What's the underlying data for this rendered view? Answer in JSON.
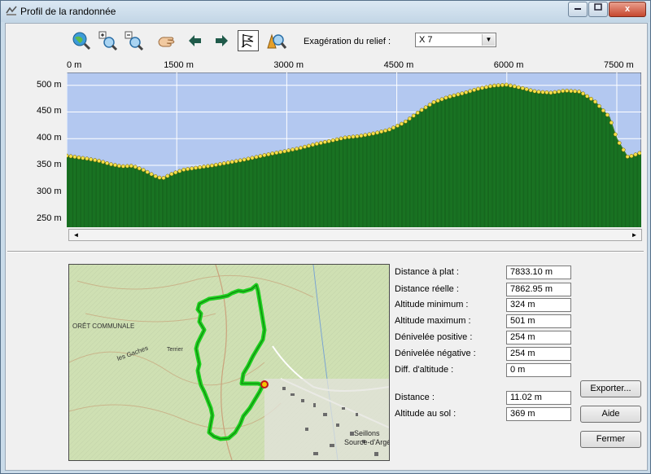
{
  "window": {
    "title": "Profil de la randonnée",
    "close_label": "x"
  },
  "toolbar": {
    "tools": [
      {
        "name": "zoom-globe-icon"
      },
      {
        "name": "zoom-in-icon"
      },
      {
        "name": "zoom-out-icon"
      },
      {
        "name": "hand-pan-icon"
      },
      {
        "name": "arrow-left-icon"
      },
      {
        "name": "arrow-right-icon"
      },
      {
        "name": "flag-icon",
        "active": true
      },
      {
        "name": "profile-search-icon"
      }
    ],
    "exaggeration_label": "Exagération du relief :",
    "exaggeration_value": "X 7"
  },
  "chart_data": {
    "type": "area",
    "x_unit": "m",
    "y_unit": "m",
    "x_ticks": [
      "0 m",
      "1500 m",
      "3000 m",
      "4500 m",
      "6000 m",
      "7500 m"
    ],
    "y_ticks": [
      "500 m",
      "450 m",
      "400 m",
      "350 m",
      "300 m",
      "250 m"
    ],
    "xlim": [
      0,
      7833
    ],
    "ylim": [
      234,
      524
    ],
    "grid": true,
    "colors": {
      "plot_bg": "#b3c8f0",
      "fill": "#1f8a2a",
      "outline": "#3b7d21",
      "point": "#f5e04a",
      "grid": "#ffffff"
    },
    "x": [
      0,
      150,
      300,
      450,
      600,
      750,
      900,
      1050,
      1200,
      1300,
      1450,
      1600,
      1800,
      2000,
      2200,
      2400,
      2600,
      2800,
      3000,
      3200,
      3400,
      3600,
      3800,
      4000,
      4200,
      4400,
      4600,
      4800,
      5000,
      5200,
      5400,
      5600,
      5800,
      6000,
      6200,
      6400,
      6600,
      6800,
      7000,
      7200,
      7400,
      7500,
      7650,
      7833
    ],
    "y": [
      368,
      365,
      362,
      358,
      352,
      348,
      349,
      341,
      330,
      325,
      335,
      342,
      346,
      350,
      355,
      360,
      366,
      372,
      377,
      383,
      390,
      396,
      402,
      405,
      410,
      417,
      430,
      450,
      468,
      478,
      485,
      493,
      499,
      501,
      495,
      488,
      486,
      490,
      488,
      470,
      440,
      400,
      365,
      374
    ]
  },
  "scrollbar": {
    "left_arrow": "◄",
    "right_arrow": "►"
  },
  "stats": [
    {
      "label": "Distance à plat :",
      "value": "7833.10 m"
    },
    {
      "label": "Distance réelle :",
      "value": "7862.95 m"
    },
    {
      "label": "Altitude minimum :",
      "value": "324 m"
    },
    {
      "label": "Altitude maximum :",
      "value": "501 m"
    },
    {
      "label": "Dénivelée positive :",
      "value": "254 m"
    },
    {
      "label": "Dénivelée négative :",
      "value": "254 m"
    },
    {
      "label": "Diff. d'altitude :",
      "value": "0 m"
    }
  ],
  "cursor": [
    {
      "label": "Distance :",
      "value": "11.02 m"
    },
    {
      "label": "Altitude au sol :",
      "value": "369 m"
    }
  ],
  "buttons": {
    "export": "Exporter...",
    "help": "Aide",
    "close": "Fermer"
  },
  "map": {
    "labels": [
      {
        "text": "ORÊT COMMUNALE"
      },
      {
        "text": "les Gaches"
      },
      {
        "text": "Terrier"
      },
      {
        "text": "Seillons"
      },
      {
        "text": "Source-d'Argé"
      }
    ]
  }
}
